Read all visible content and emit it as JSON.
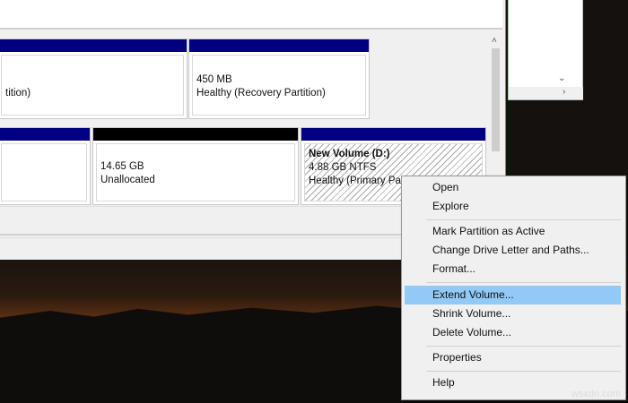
{
  "disks": {
    "row1": [
      {
        "size": "",
        "status": "tition)"
      },
      {
        "size": "450 MB",
        "status": "Healthy (Recovery Partition)"
      }
    ],
    "row2": [
      {
        "size": "",
        "status": ""
      },
      {
        "size": "14.65 GB",
        "status": "Unallocated"
      },
      {
        "name": "New Volume  (D:)",
        "size": "4.88 GB NTFS",
        "status": "Healthy (Primary Partition)"
      }
    ]
  },
  "colors": {
    "primary": "#000080",
    "unallocated": "#000000",
    "highlight": "#91c9f7"
  },
  "context_menu": {
    "items": [
      "Open",
      "Explore",
      "Mark Partition as Active",
      "Change Drive Letter and Paths...",
      "Format...",
      "Extend Volume...",
      "Shrink Volume...",
      "Delete Volume...",
      "Properties",
      "Help"
    ],
    "highlighted": "Extend Volume..."
  },
  "watermark": "wsxdn.com"
}
